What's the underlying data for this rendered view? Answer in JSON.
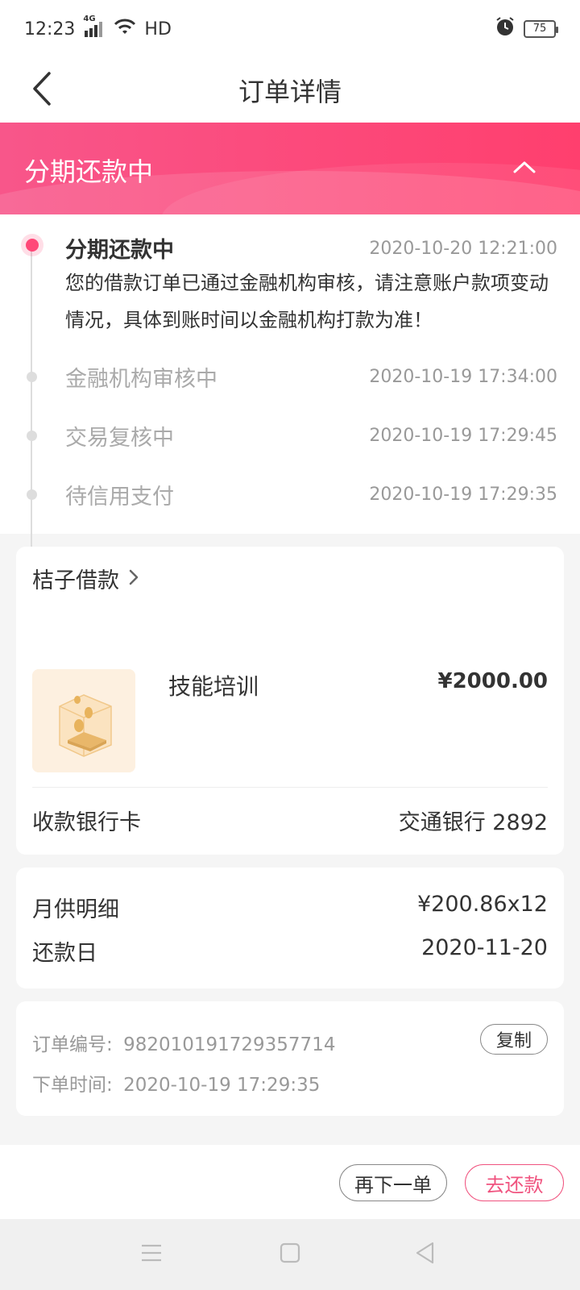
{
  "status_bar": {
    "time": "12:23",
    "network": "4G",
    "wifi_label": "HD",
    "battery": "75"
  },
  "header": {
    "title": "订单详情"
  },
  "banner": {
    "title": "分期还款中"
  },
  "timeline": [
    {
      "title": "分期还款中",
      "time": "2020-10-20 12:21:00",
      "desc": "您的借款订单已通过金融机构审核，请注意账户款项变动情况，具体到账时间以金融机构打款为准！",
      "active": true
    },
    {
      "title": "金融机构审核中",
      "time": "2020-10-19 17:34:00",
      "active": false
    },
    {
      "title": "交易复核中",
      "time": "2020-10-19 17:29:45",
      "active": false
    },
    {
      "title": "待信用支付",
      "time": "2020-10-19 17:29:35",
      "active": false
    }
  ],
  "product_card": {
    "merchant": "桔子借款",
    "product_name": "技能培训",
    "price": "¥2000.00",
    "bank_label": "收款银行卡",
    "bank_value": "交通银行 2892"
  },
  "repay_card": {
    "monthly_label": "月供明细",
    "monthly_value": "¥200.86x12",
    "date_label": "还款日",
    "date_value": "2020-11-20"
  },
  "order_info": {
    "number_label": "订单编号:",
    "number_value": "982010191729357714",
    "time_label": "下单时间:",
    "time_value": "2020-10-19 17:29:35",
    "copy_label": "复制"
  },
  "actions": {
    "reorder_label": "再下一单",
    "repay_label": "去还款"
  },
  "colors": {
    "accent": "#ff4878",
    "banner_start": "#f8568a",
    "banner_end": "#ff3f6e"
  }
}
